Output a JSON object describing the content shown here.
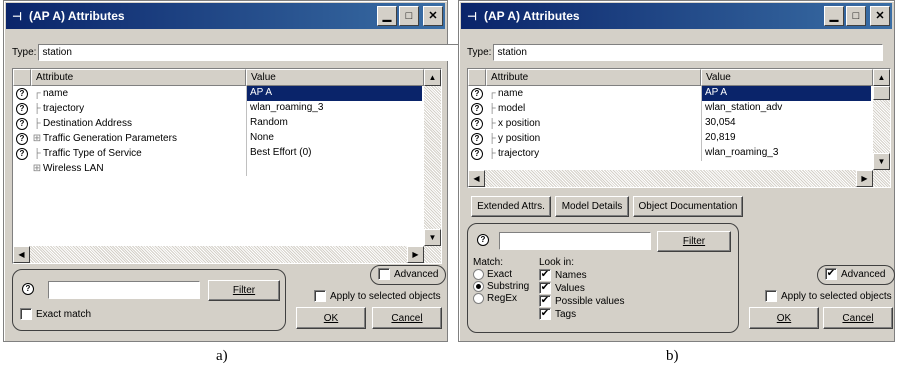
{
  "window_a": {
    "title": "(AP A) Attributes",
    "type_label": "Type:",
    "type_value": "station",
    "columns": [
      "Attribute",
      "Value"
    ],
    "rows": [
      {
        "tree": "┌",
        "name": "name",
        "value": "AP A",
        "selected": true
      },
      {
        "tree": "├",
        "name": "trajectory",
        "value": "wlan_roaming_3"
      },
      {
        "tree": "├",
        "name": "Destination Address",
        "value": "Random"
      },
      {
        "tree": "⊞",
        "name": "Traffic Generation Parameters",
        "value": "None"
      },
      {
        "tree": "├",
        "name": "Traffic Type of Service",
        "value": "Best Effort (0)"
      },
      {
        "tree": "⊞",
        "name": "Wireless LAN",
        "value": "",
        "no_icon": true
      }
    ],
    "filter_button": "Filter",
    "exact_match": "Exact match",
    "advanced": "Advanced",
    "apply_selected": "Apply to selected objects",
    "ok": "OK",
    "cancel": "Cancel"
  },
  "window_b": {
    "title": "(AP A) Attributes",
    "type_label": "Type:",
    "type_value": "station",
    "columns": [
      "Attribute",
      "Value"
    ],
    "rows": [
      {
        "tree": "┌",
        "name": "name",
        "value": "AP A",
        "selected": true
      },
      {
        "tree": "├",
        "name": "model",
        "value": "wlan_station_adv"
      },
      {
        "tree": "├",
        "name": "x position",
        "value": "30,054"
      },
      {
        "tree": "├",
        "name": "y position",
        "value": "20,819"
      },
      {
        "tree": "├",
        "name": "trajectory",
        "value": "wlan_roaming_3"
      }
    ],
    "btn_extended": "Extended Attrs.",
    "btn_model": "Model Details",
    "btn_doc": "Object Documentation",
    "filter_button": "Filter",
    "match_label": "Match:",
    "match_exact": "Exact",
    "match_substring": "Substring",
    "match_regex": "RegEx",
    "lookin_label": "Look in:",
    "lookin_names": "Names",
    "lookin_values": "Values",
    "lookin_possible": "Possible values",
    "lookin_tags": "Tags",
    "advanced": "Advanced",
    "apply_selected": "Apply to selected objects",
    "ok": "OK",
    "cancel": "Cancel"
  },
  "captions": {
    "a": "a)",
    "b": "b)"
  },
  "icons": {
    "help": "question-mark-icon",
    "pin": "pushpin-icon"
  }
}
